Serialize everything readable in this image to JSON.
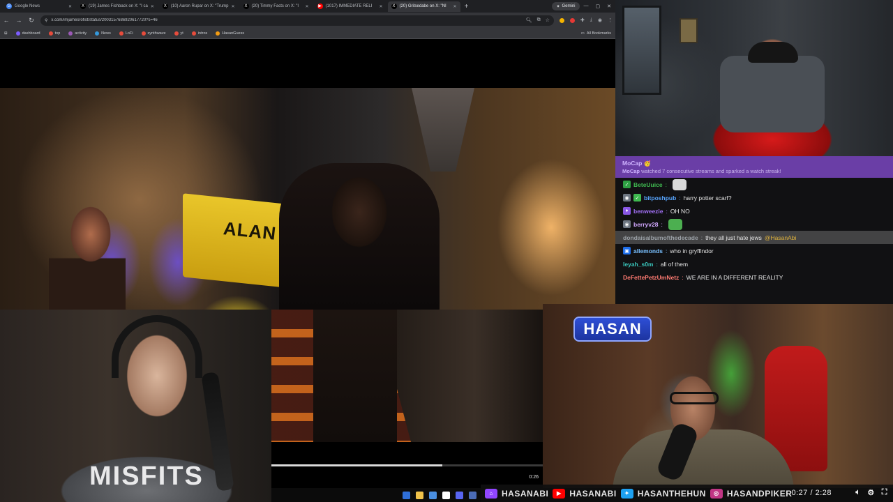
{
  "browser": {
    "tabs": [
      {
        "label": "Google News",
        "icon": "google-news-icon",
        "color": "#4285f4",
        "glyph": "G",
        "active": false
      },
      {
        "label": "(19) James Fishback on X: \"I ca",
        "icon": "x-logo-icon",
        "color": "#000000",
        "glyph": "X",
        "active": false
      },
      {
        "label": "(10) Aaron Rupar on X: \"Trump",
        "icon": "x-logo-icon",
        "color": "#000000",
        "glyph": "X",
        "active": false
      },
      {
        "label": "(20) Timmy Facts on X: \"I",
        "icon": "x-logo-icon",
        "color": "#000000",
        "glyph": "X",
        "active": false
      },
      {
        "label": "(1017) IMMEDIATE RELI",
        "icon": "youtube-icon",
        "color": "#ff0000",
        "glyph": "▶",
        "active": false
      },
      {
        "label": "(20) Gritsedabe on X: \"NI",
        "icon": "x-logo-icon",
        "color": "#000000",
        "glyph": "X",
        "active": true
      }
    ],
    "new_tab": "+",
    "gemini_label": "Gemini",
    "url": "x.com/imjamesrofist/status/2003157686920617720?s=46",
    "bookmarks": [
      {
        "label": "dashboard",
        "color": "#7c5cff"
      },
      {
        "label": "top",
        "color": "#e74c3c"
      },
      {
        "label": "activity",
        "color": "#9b59b6"
      },
      {
        "label": "News",
        "color": "#3498db"
      },
      {
        "label": "LoFi",
        "color": "#e74c3c"
      },
      {
        "label": "synthwave",
        "color": "#e74c3c"
      },
      {
        "label": "yt",
        "color": "#e74c3c"
      },
      {
        "label": "intros",
        "color": "#e74c3c"
      },
      {
        "label": "HasanGuess",
        "color": "#f39c12"
      }
    ],
    "all_bookmarks": "All Bookmarks"
  },
  "video": {
    "truck_text": "ALAN",
    "progress": 0.63,
    "time": "0:26"
  },
  "asmon": {
    "shirt_text": "MISFITS"
  },
  "hasan": {
    "logo_text": "HASAN"
  },
  "social_bar": {
    "items": [
      {
        "icon": "twitch-icon",
        "color": "#9146ff",
        "glyph": "⌂",
        "label": "HASANABI"
      },
      {
        "icon": "youtube-icon",
        "color": "#ff0000",
        "glyph": "▶",
        "label": "HASANABI"
      },
      {
        "icon": "twitter-icon",
        "color": "#1da1f2",
        "glyph": "✦",
        "label": "HASANTHEHUN"
      },
      {
        "icon": "instagram-icon",
        "color": "#c13584",
        "glyph": "◎",
        "label": "HASANDPIKER"
      }
    ],
    "time": "0:27 / 2:28"
  },
  "chat": {
    "banner": {
      "name": "MoCap",
      "message_name": "MoCap",
      "message": "watched 7 consecutive streams and sparked a watch streak!"
    },
    "messages": [
      {
        "user": "BeteUuice",
        "color": "#3fb950",
        "text": "",
        "emote": true,
        "emote_color": "#d9d9d9",
        "badges": [
          {
            "color": "#2ea043",
            "glyph": "✓"
          }
        ],
        "highlight": false
      },
      {
        "user": "bitposhpub",
        "color": "#58a6ff",
        "text": "harry potter scarf?",
        "emote": false,
        "badges": [
          {
            "color": "#6e7681",
            "glyph": "◉"
          },
          {
            "color": "#3fb950",
            "glyph": "✓"
          }
        ],
        "highlight": false
      },
      {
        "user": "benweezie",
        "color": "#a371f7",
        "text": "OH NO",
        "emote": false,
        "badges": [
          {
            "color": "#8957e5",
            "glyph": "♦"
          }
        ],
        "highlight": false
      },
      {
        "user": "berryv28",
        "color": "#d2a8ff",
        "text": "",
        "emote": true,
        "emote_color": "#4caf50",
        "badges": [
          {
            "color": "#6e7681",
            "glyph": "◉"
          }
        ],
        "highlight": false
      },
      {
        "user": "dondaisalbumofthedecade",
        "color": "#9aa0a6",
        "text": "they all just hate jews",
        "mention": "@HasanAbi",
        "emote": false,
        "badges": [],
        "highlight": true
      },
      {
        "user": "allemonds",
        "color": "#79c0ff",
        "text": "who in gryffindor",
        "emote": false,
        "badges": [
          {
            "color": "#1f6feb",
            "glyph": "▣"
          }
        ],
        "highlight": false
      },
      {
        "user": "leyah_s0m",
        "color": "#39c5bb",
        "text": "all of them",
        "emote": false,
        "badges": [],
        "highlight": false
      },
      {
        "user": "DeFettePetzUmNetz",
        "color": "#ff7b72",
        "text": "WE ARE IN A DIFFERENT REALITY",
        "emote": false,
        "badges": [],
        "highlight": false
      }
    ]
  }
}
